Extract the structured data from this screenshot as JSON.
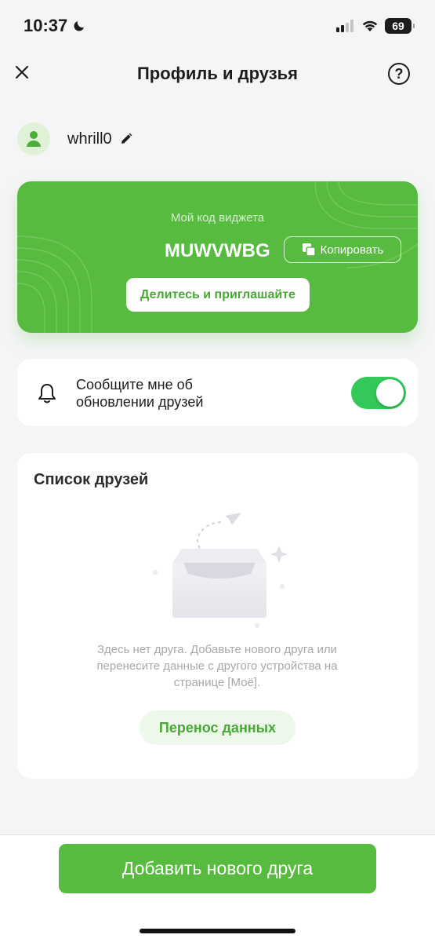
{
  "status_bar": {
    "time": "10:37",
    "battery": "69"
  },
  "header": {
    "title": "Профиль и друзья"
  },
  "profile": {
    "username": "whrill0"
  },
  "widget": {
    "label": "Мой код виджета",
    "code": "MUWVWBG",
    "copy_label": "Копировать",
    "share_label": "Делитесь и приглашайте"
  },
  "notify": {
    "text": "Сообщите мне об обновлении друзей",
    "enabled": true
  },
  "friends": {
    "title": "Список друзей",
    "empty_text": "Здесь нет друга. Добавьте нового друга или перенесите данные с другого устройства на странице [Моё].",
    "transfer_label": "Перенос данных"
  },
  "bottom": {
    "add_label": "Добавить нового друга"
  },
  "colors": {
    "accent": "#57bb3f",
    "toggle_on": "#34c759",
    "background": "#f5f5f7"
  }
}
